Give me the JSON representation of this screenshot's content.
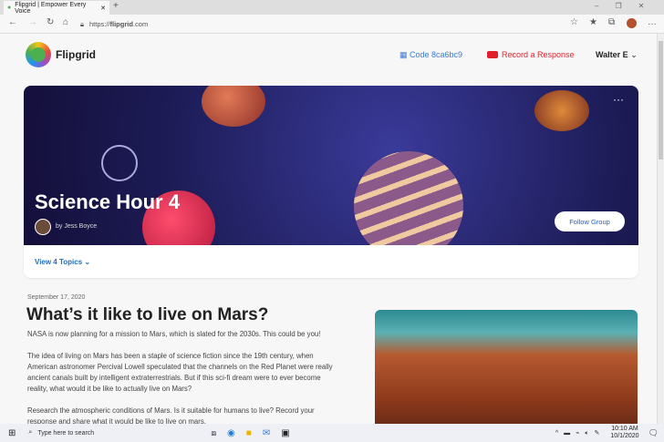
{
  "browser": {
    "tab_title": "Flipgrid | Empower Every Voice",
    "url_prefix": "https://",
    "url_domain": "flipgrid",
    "url_suffix": ".com"
  },
  "header": {
    "logo": "Flipgrid",
    "code": "Code 8ca6bc9",
    "record": "Record a Response",
    "user": "Walter E"
  },
  "hero": {
    "title": "Science Hour 4",
    "byline": "by Jess Boyce",
    "follow": "Follow Group",
    "more": "···"
  },
  "topics": {
    "label": "View 4 Topics"
  },
  "post": {
    "date": "September 17, 2020",
    "title": "What’s it like to live on Mars?",
    "p1": "NASA is now planning for a mission to Mars, which is slated for the 2030s. This could be you!",
    "p2": "The idea of living on Mars has been a staple of science fiction since the 19th century, when American astronomer Percival Lowell speculated that the channels on the Red Planet were really ancient canals built by intelligent extraterrestrials. But if this sci-fi dream were to ever become reality, what would it be like to actually live on Mars?",
    "p3": "Research the atmospheric conditions of Mars. Is it suitable for humans to live? Record your response and share what it would be like to live on mars."
  },
  "taskbar": {
    "search": "Type here to search",
    "time": "10:10 AM",
    "date": "10/1/2020"
  }
}
